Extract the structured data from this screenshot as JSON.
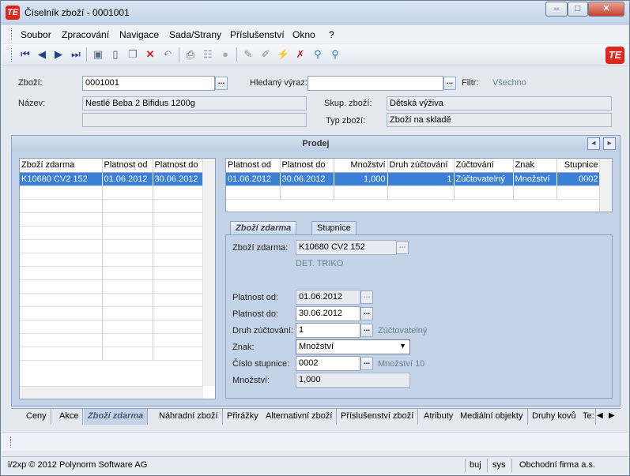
{
  "window": {
    "title": "Číselník zboží - 0001001",
    "logo": "TE",
    "min": "–",
    "max": "□",
    "close": "✕"
  },
  "menu": [
    "Soubor",
    "Zpracování",
    "Navigace",
    "Sada/Strany",
    "Příslušenství",
    "Okno",
    "?"
  ],
  "toolbar_icons": [
    "first-record-icon",
    "prev-record-icon",
    "next-record-icon",
    "last-record-icon",
    "save-icon",
    "new-icon",
    "copy-icon",
    "delete-icon",
    "undo-icon",
    "print-icon",
    "tree-icon",
    "cancel-icon",
    "edit-icon",
    "edit-alt-icon",
    "tools-icon",
    "filter-icon",
    "search-icon",
    "search-advanced-icon"
  ],
  "header": {
    "zbozi_label": "Zboží:",
    "zbozi_value": "0001001",
    "hledany_label": "Hledaný výraz:",
    "hledany_value": "",
    "filtr_label": "Filtr:",
    "filtr_value": "Všechno",
    "nazev_label": "Název:",
    "nazev_value": "Nestlé Beba 2 Bifidus 1200g",
    "nazev2_value": "",
    "skup_label": "Skup. zboží:",
    "skup_value": "Dětská výživa",
    "typ_label": "Typ zboží:",
    "typ_value": "Zboží na skladě",
    "dots": "..."
  },
  "panel": {
    "title": "Prodej",
    "nav_left": "◂",
    "nav_right": "▸"
  },
  "left_grid": {
    "columns": [
      "Zboží zdarma",
      "Platnost od",
      "Platnost do"
    ],
    "rows": [
      [
        "K10680 CV2 152",
        "01.06.2012",
        "30.06.2012"
      ]
    ]
  },
  "right_grid": {
    "columns": [
      "Platnost od",
      "Platnost do",
      "Množství",
      "Druh zúčtování",
      "Zúčtování",
      "Znak",
      "Stupnice"
    ],
    "rows": [
      [
        "01.06.2012",
        "30.06.2012",
        "1,000",
        "1",
        "Zúčtovatelný",
        "Množství",
        "0002"
      ]
    ]
  },
  "detail_tabs": [
    "Zboží zdarma",
    "Stupnice"
  ],
  "detail": {
    "zbozi_zdarma_label": "Zboží zdarma:",
    "zbozi_zdarma_value": "K10680 CV2 152",
    "zbozi_zdarma_desc": "DET. TRIKO",
    "platnost_od_label": "Platnost od:",
    "platnost_od_value": "01.06.2012",
    "platnost_do_label": "Platnost do:",
    "platnost_do_value": "30.06.2012",
    "druh_label": "Druh zúčtování:",
    "druh_value": "1",
    "druh_desc": "Zúčtovatelný",
    "znak_label": "Znak:",
    "znak_value": "Množství",
    "cislo_label": "Číslo stupnice:",
    "cislo_value": "0002",
    "cislo_desc": "Množství 10",
    "mnozstvi_label": "Množství:",
    "mnozstvi_value": "1,000"
  },
  "bottom_tabs": [
    "Ceny",
    "Akce",
    "Zboží zdarma",
    "Náhradní zboží",
    "Přirážky",
    "Alternativní zboží",
    "Příslušenství zboží",
    "Atributy",
    "Mediální objekty",
    "Druhy kovů",
    "Te:"
  ],
  "status": {
    "copyright": "i/2xp © 2012 Polynorm Software AG",
    "user": "buj",
    "db": "sys",
    "company": "Obchodní firma a.s."
  }
}
